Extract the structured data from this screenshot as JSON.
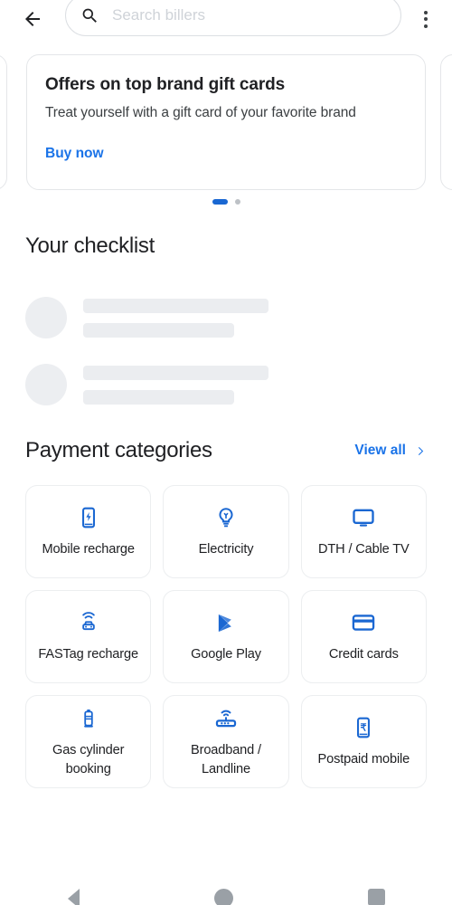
{
  "appbar": {
    "back_icon": "arrow-back-icon",
    "overflow_icon": "more-vert-icon",
    "search": {
      "icon": "search-icon",
      "placeholder": "Search billers",
      "value": ""
    }
  },
  "offer_carousel": {
    "cards": [
      {
        "title": "Offers on top brand gift cards",
        "subtitle": "Treat yourself with a gift card of your favorite brand",
        "cta": "Buy now"
      }
    ],
    "dots": [
      {
        "active": true
      },
      {
        "active": false
      }
    ],
    "active_color": "#1967d2",
    "inactive_color": "#bdc1c6"
  },
  "checklist": {
    "title": "Your checklist",
    "loading": true,
    "skeleton_rows": 2
  },
  "payment_categories": {
    "title": "Payment categories",
    "view_all_label": "View all",
    "view_all_icon": "chevron-right-icon",
    "accent_color": "#1a73e8",
    "icon_color": "#1a67d2",
    "tiles": [
      {
        "label": "Mobile recharge",
        "icon": "mobile-recharge-icon"
      },
      {
        "label": "Electricity",
        "icon": "lightbulb-icon"
      },
      {
        "label": "DTH / Cable TV",
        "icon": "tv-monitor-icon"
      },
      {
        "label": "FASTag recharge",
        "icon": "fastag-car-icon"
      },
      {
        "label": "Google Play",
        "icon": "google-play-icon"
      },
      {
        "label": "Credit cards",
        "icon": "credit-card-icon"
      },
      {
        "label": "Gas cylinder booking",
        "icon": "gas-cylinder-icon"
      },
      {
        "label": "Broadband / Landline",
        "icon": "router-wifi-icon"
      },
      {
        "label": "Postpaid mobile",
        "icon": "postpaid-rupee-icon"
      }
    ]
  },
  "system_nav": {
    "back_icon": "system-back-icon",
    "home_icon": "system-home-icon",
    "recents_icon": "system-recents-icon"
  }
}
